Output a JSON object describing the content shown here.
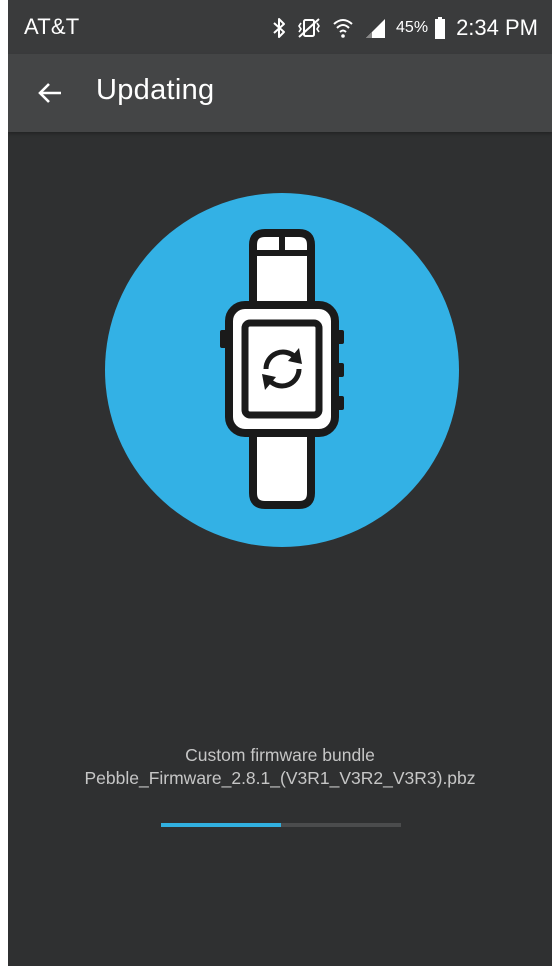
{
  "status_bar": {
    "carrier": "AT&T",
    "battery_percent": "45%",
    "time": "2:34 PM",
    "icons": [
      "bluetooth-icon",
      "vibrate-icon",
      "wifi-icon",
      "signal-icon",
      "battery-icon"
    ]
  },
  "app_bar": {
    "title": "Updating",
    "back_icon": "arrow-left-icon"
  },
  "hero": {
    "icon": "watch-sync-icon",
    "circle_color": "#33b1e5"
  },
  "update": {
    "label": "Custom firmware bundle",
    "filename": "Pebble_Firmware_2.8.1_(V3R1_V3R2_V3R3).pbz",
    "progress": 0.5
  },
  "colors": {
    "background": "#2f3031",
    "app_bar": "#444546",
    "status_bar": "#3a3b3c",
    "accent": "#31b0e0",
    "caption_text": "#c6c6c6"
  }
}
